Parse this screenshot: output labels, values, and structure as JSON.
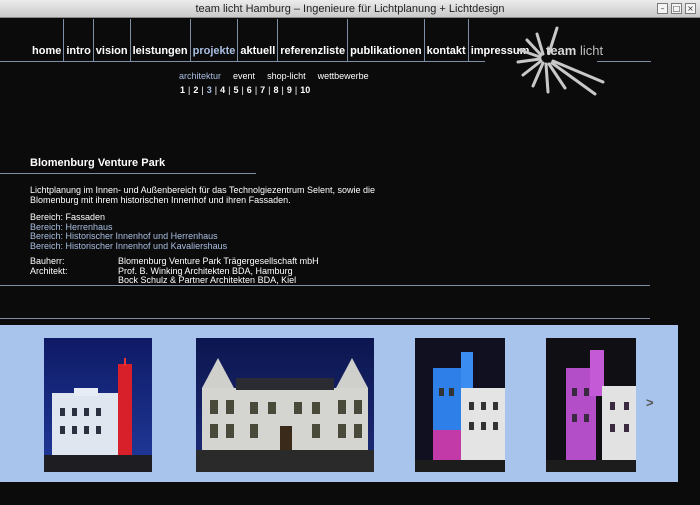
{
  "window": {
    "title": "team licht Hamburg – Ingenieure für Lichtplanung + Lichtdesign"
  },
  "nav": {
    "items": [
      {
        "label": "home"
      },
      {
        "label": "intro"
      },
      {
        "label": "vision"
      },
      {
        "label": "leistungen"
      },
      {
        "label": "projekte"
      },
      {
        "label": "aktuell"
      },
      {
        "label": "referenzliste"
      },
      {
        "label": "publikationen"
      },
      {
        "label": "kontakt"
      },
      {
        "label": "impressum"
      }
    ],
    "active": "projekte"
  },
  "logo": {
    "brand": "team",
    "suffix": " licht"
  },
  "subnav": {
    "items": [
      "architektur",
      "event",
      "shop-licht",
      "wettbewerbe"
    ],
    "active": "architektur"
  },
  "pages": {
    "items": [
      "1",
      "2",
      "3",
      "4",
      "5",
      "6",
      "7",
      "8",
      "9",
      "10"
    ],
    "active": "3"
  },
  "project": {
    "title": "Blomenburg Venture Park",
    "description": "Lichtplanung im Innen- und Außenbereich für das Technolgiezentrum Selent, sowie die Blomenburg mit ihrem historischen Innenhof und ihren Fassaden.",
    "bereich_current": "Bereich: Fassaden",
    "bereich_links": [
      "Bereich: Herrenhaus",
      "Bereich: Historischer Innenhof und Herrenhaus",
      "Bereich: Historischer Innenhof und Kavaliershaus"
    ],
    "bauherr_label": "Bauherr:",
    "bauherr": "Blomenburg Venture Park Trägergesellschaft mbH",
    "architekt_label": "Architekt:",
    "architekt": [
      "Prof. B. Winking Architekten BDA, Hamburg",
      "Bock Schulz & Partner Architekten BDA, Kiel"
    ]
  },
  "gallery": {
    "next_label": ">"
  },
  "colors": {
    "accent": "#a9bfe2",
    "gallery_bg": "#a9c4ec",
    "background": "#0b0b0b"
  }
}
